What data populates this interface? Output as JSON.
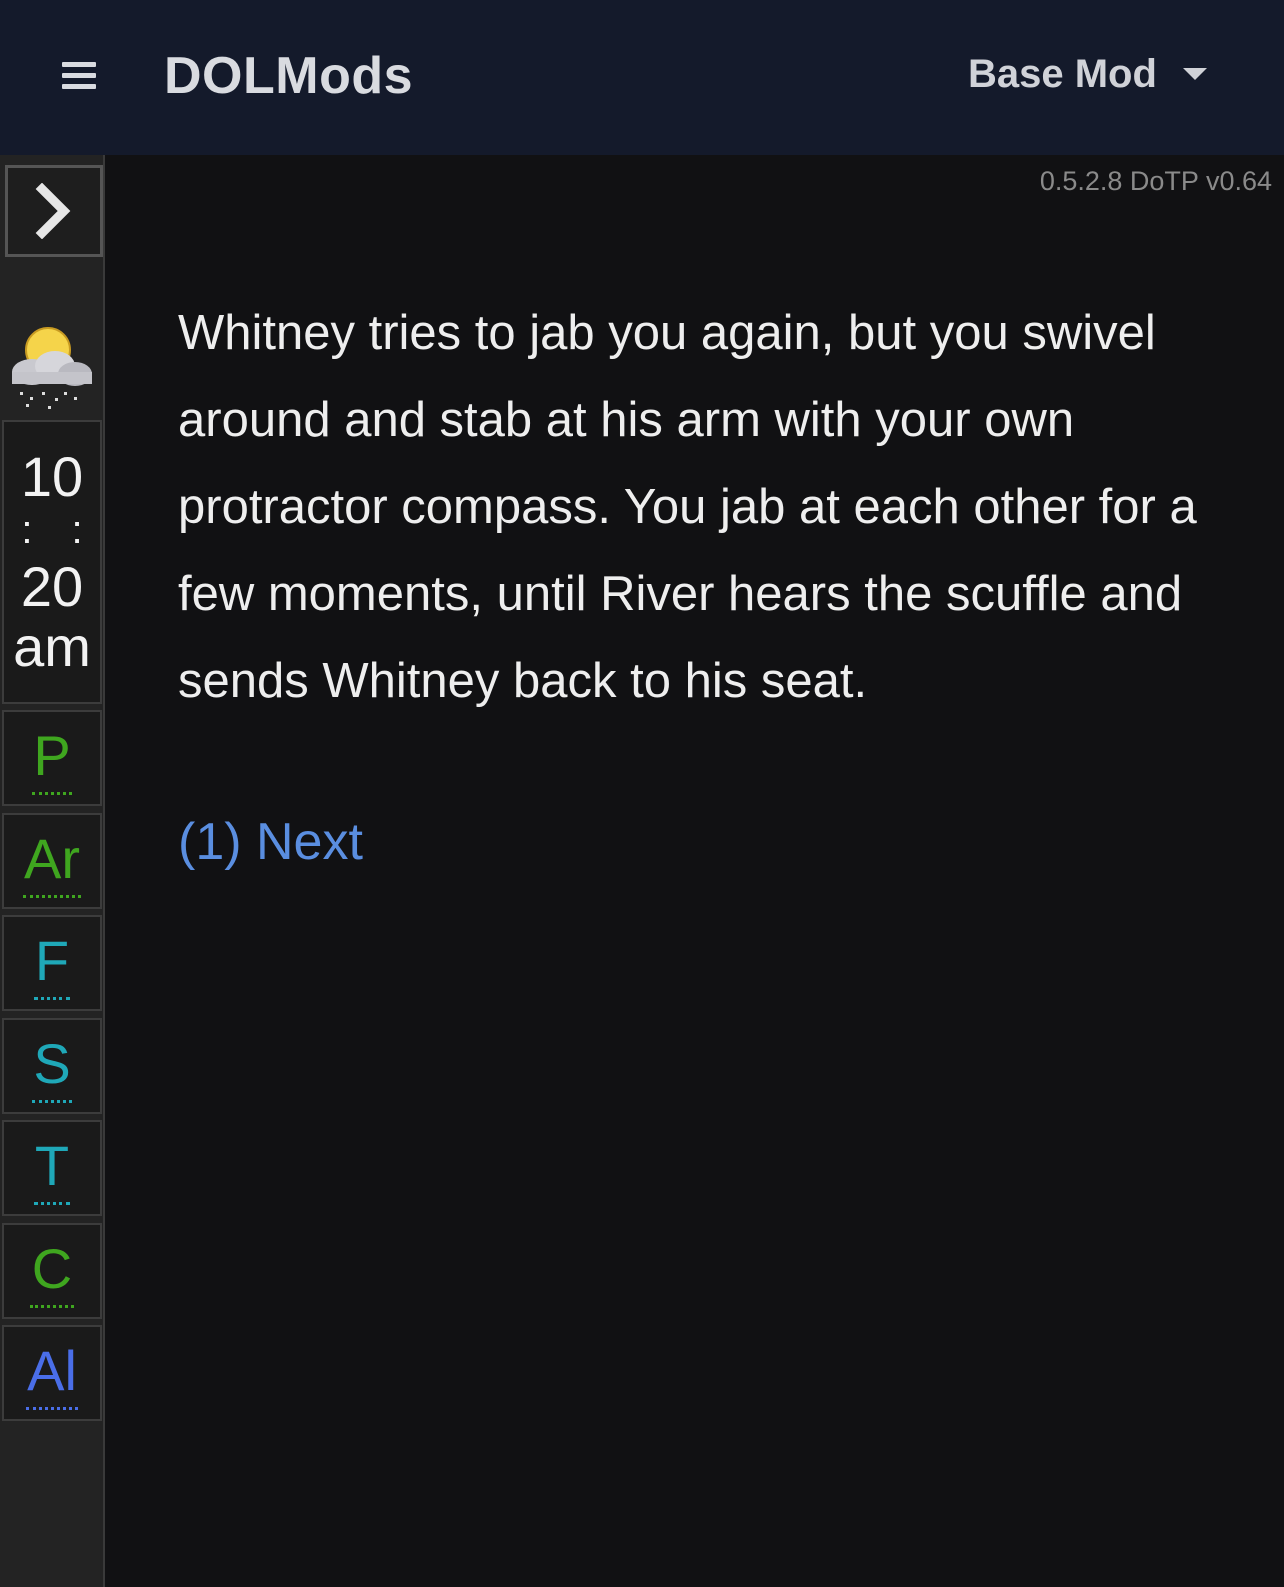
{
  "header": {
    "brand": "DOLMods",
    "mod_select": "Base Mod"
  },
  "sidebar": {
    "clock": {
      "hour": "10",
      "separator": ": :",
      "minute": "20",
      "period": "am"
    },
    "weather_icon": "sun-cloud-rain-icon",
    "stats": [
      {
        "label": "P",
        "color": "#3fa61f"
      },
      {
        "label": "Ar",
        "color": "#3fa61f"
      },
      {
        "label": "F",
        "color": "#1fa8b8"
      },
      {
        "label": "S",
        "color": "#1fa8b8"
      },
      {
        "label": "T",
        "color": "#1fa8b8"
      },
      {
        "label": "C",
        "color": "#3fa61f"
      },
      {
        "label": "Al",
        "color": "#4a6ee8"
      }
    ]
  },
  "main": {
    "version": "0.5.2.8 DoTP v0.64",
    "passage": "Whitney tries to jab you again, but you swivel around and stab at his arm with your own protractor compass. You jab at each other for a few moments, until River hears the scuffle and sends Whitney back to his seat.",
    "next_link": "(1) Next"
  }
}
